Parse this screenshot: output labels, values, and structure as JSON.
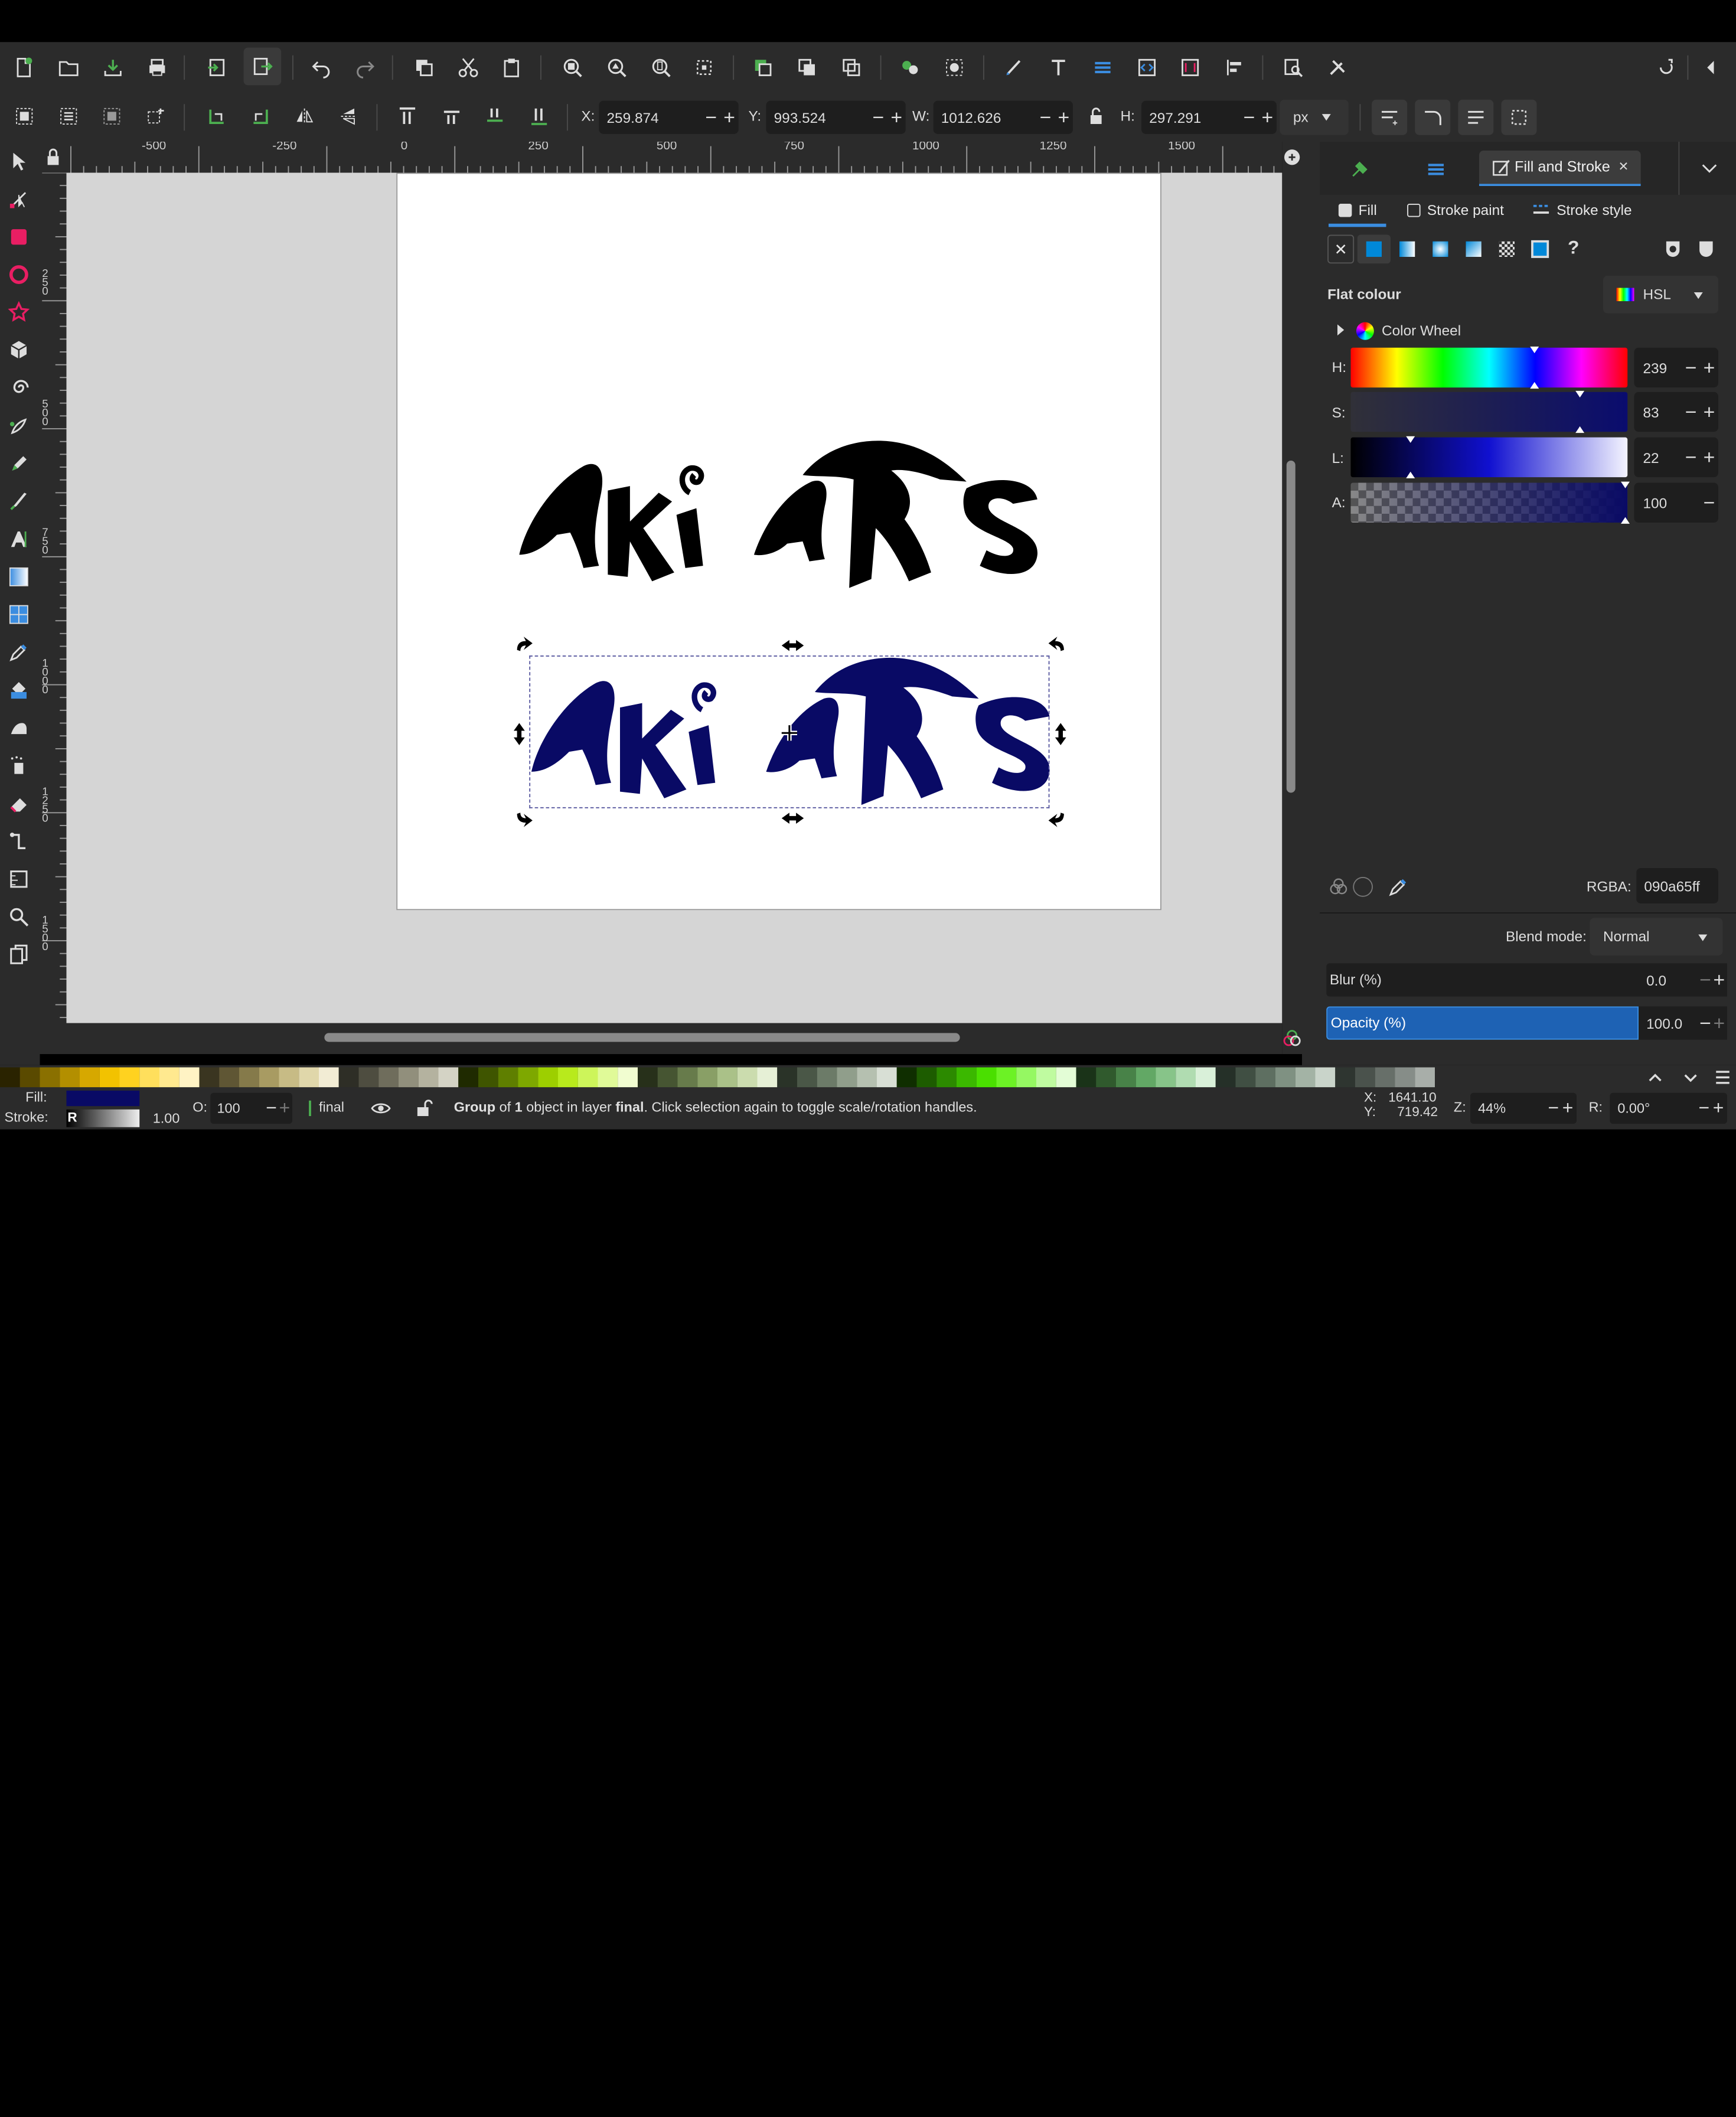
{
  "toolbar": {
    "x_label": "X:",
    "x_value": "259.874",
    "y_label": "Y:",
    "y_value": "993.524",
    "w_label": "W:",
    "w_value": "1012.626",
    "h_label": "H:",
    "h_value": "297.291",
    "unit": "px"
  },
  "ruler": {
    "h_ticks": [
      "-500",
      "-250",
      "0",
      "250",
      "500",
      "750",
      "1000",
      "1250",
      "1500"
    ],
    "v_ticks": [
      "250",
      "500",
      "750",
      "1000",
      "1250",
      "1500"
    ]
  },
  "canvas": {
    "logo_top_text": "AKi ARTS",
    "logo_bottom_text": "AKi ARTS",
    "logo_top_color": "#000000",
    "logo_bottom_color": "#090a65"
  },
  "panel": {
    "dialog_tab_label": "Fill and Stroke",
    "subtab_fill": "Fill",
    "subtab_stroke_paint": "Stroke paint",
    "subtab_stroke_style": "Stroke style",
    "unknown_paint_label": "?",
    "flat_colour_label": "Flat colour",
    "color_mode": "HSL",
    "color_wheel_label": "Color Wheel",
    "h_label": "H:",
    "h_value": "239",
    "s_label": "S:",
    "s_value": "83",
    "l_label": "L:",
    "l_value": "22",
    "a_label": "A:",
    "a_value": "100",
    "rgba_label": "RGBA:",
    "rgba_value": "090a65ff",
    "blend_label": "Blend mode:",
    "blend_value": "Normal",
    "blur_label": "Blur (%)",
    "blur_value": "0.0",
    "opacity_label": "Opacity (%)",
    "opacity_value": "100.0",
    "accent": "#3b8de0"
  },
  "status": {
    "fill_label": "Fill:",
    "stroke_label": "Stroke:",
    "stroke_value": "R",
    "stroke_width": "1.00",
    "opacity_label": "O:",
    "opacity_value": "100",
    "layer_name": "final",
    "message_prefix": "Group",
    "message_of": " of ",
    "message_count": "1",
    "message_mid": " object in layer ",
    "message_layer": "final",
    "message_suffix": ". Click selection again to toggle scale/rotation handles.",
    "cursor_x_label": "X:",
    "cursor_x": "1641.10",
    "cursor_y_label": "Y:",
    "cursor_y": "719.42",
    "zoom_label": "Z:",
    "zoom_value": "44%",
    "rotate_label": "R:",
    "rotate_value": "0.00°"
  },
  "palette_colors": [
    "#2a2300",
    "#5a4a00",
    "#8a7000",
    "#b38f00",
    "#d6a800",
    "#f2c200",
    "#ffd21f",
    "#ffdf5c",
    "#ffe98f",
    "#fff3c4",
    "#3a3520",
    "#5f5634",
    "#857a4a",
    "#a89b62",
    "#c7bb85",
    "#e0d7aa",
    "#f2ecd4",
    "#2e2e26",
    "#4e4d40",
    "#6f6d5c",
    "#918f7c",
    "#b4b29f",
    "#d4d3c5",
    "#1f2a00",
    "#3f5500",
    "#5f7f00",
    "#7ea800",
    "#9dcf00",
    "#b8ea1c",
    "#cdf55a",
    "#e0fa98",
    "#f1fdd0",
    "#27301a",
    "#465532",
    "#677b4b",
    "#899f66",
    "#aac188",
    "#cbdcae",
    "#e6f0d6",
    "#2a3328",
    "#4a5747",
    "#6c7b68",
    "#909e8b",
    "#b5c0b0",
    "#d8dfd5",
    "#0f2e00",
    "#1d5c00",
    "#2c8a00",
    "#3bb800",
    "#4adf00",
    "#6cf225",
    "#95f862",
    "#bffba0",
    "#e3fdd6",
    "#1a3318",
    "#305a2d",
    "#488248",
    "#62a865",
    "#87c489",
    "#b0dcb1",
    "#d9f0d9",
    "#253028",
    "#404f43",
    "#5e6f61",
    "#7f9182",
    "#a3b3a5",
    "#c9d4ca",
    "#2e3530",
    "#4a524c",
    "#676f69",
    "#868d88",
    "#a8aea9"
  ]
}
